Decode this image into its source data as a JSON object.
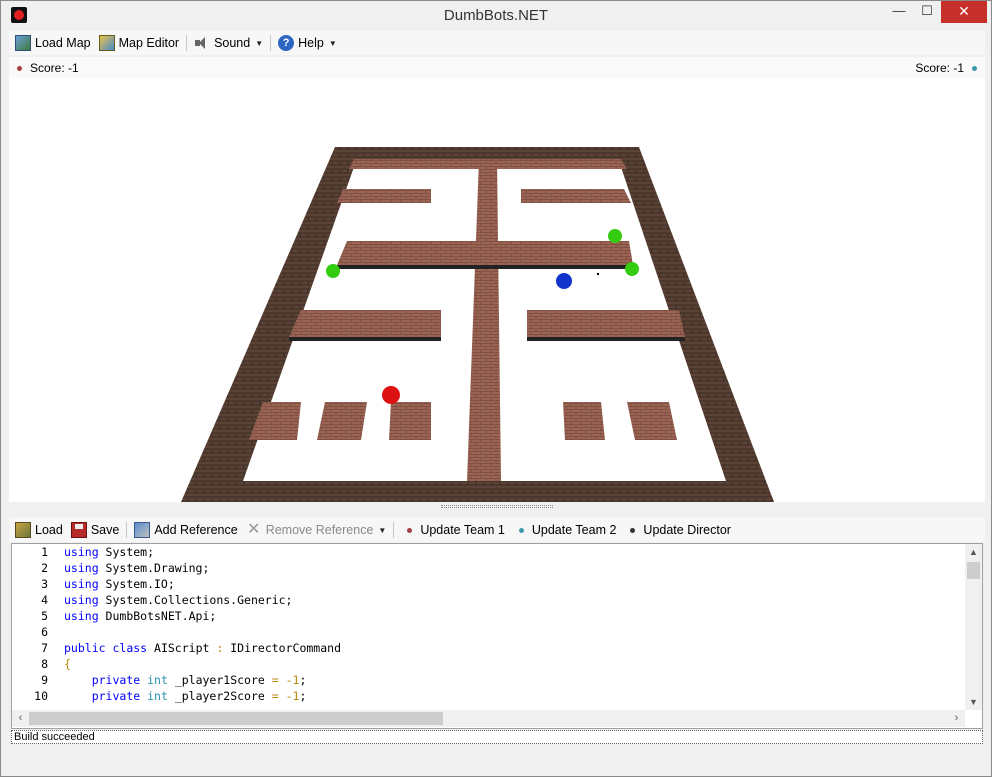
{
  "window": {
    "title": "DumbBots.NET",
    "minimize": "—",
    "maximize": "☐",
    "close": "✕"
  },
  "menu": {
    "load_map": "Load Map",
    "map_editor": "Map Editor",
    "sound": "Sound",
    "help": "Help"
  },
  "scores": {
    "team1": "Score: -1",
    "team2": "Score: -1",
    "team1_color": "#a54040",
    "team2_color": "#3a9aa8"
  },
  "arena": {
    "bots": [
      {
        "name": "green-bot",
        "color": "#33cc11"
      },
      {
        "name": "green-bot",
        "color": "#33cc11"
      },
      {
        "name": "green-bot",
        "color": "#33cc11"
      },
      {
        "name": "blue-bot",
        "color": "#1133cc"
      },
      {
        "name": "red-bot",
        "color": "#dd1111"
      }
    ],
    "wall_color": "#8b5a48"
  },
  "editor_toolbar": {
    "load": "Load",
    "save": "Save",
    "add_reference": "Add Reference",
    "remove_reference": "Remove Reference",
    "update_team1": "Update Team 1",
    "update_team2": "Update Team 2",
    "update_director": "Update Director"
  },
  "editor": {
    "line_numbers": [
      "1",
      "2",
      "3",
      "4",
      "5",
      "6",
      "7",
      "8",
      "9",
      "10"
    ]
  },
  "status": {
    "text": "Build succeeded"
  }
}
